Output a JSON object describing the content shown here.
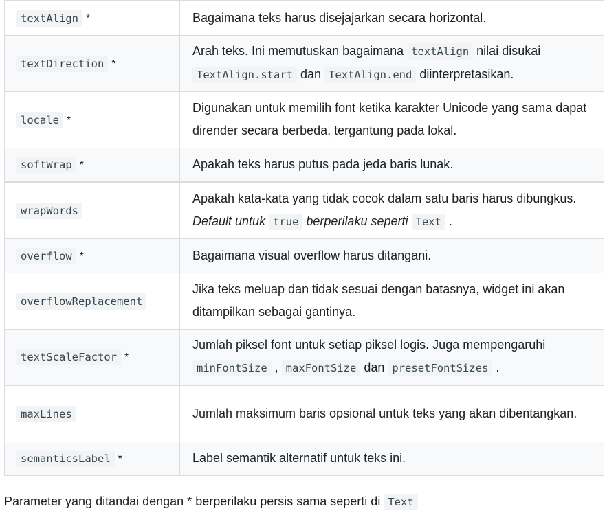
{
  "rows": [
    {
      "name": "textAlign",
      "star": "*",
      "desc": "Bagaimana teks harus disejajarkan secara horizontal."
    },
    {
      "name": "textDirection",
      "star": "*",
      "d1": "Arah teks. Ini memutuskan bagaimana ",
      "c1": "textAlign",
      "d2": " nilai disukai ",
      "c2": "TextAlign.start",
      "d3": " dan ",
      "c3": "TextAlign.end",
      "d4": " diinterpretasikan."
    },
    {
      "name": "locale",
      "star": "*",
      "desc": "Digunakan untuk memilih font ketika karakter Unicode yang sama dapat dirender secara berbeda, tergantung pada lokal."
    },
    {
      "name": "softWrap",
      "star": "*",
      "desc": "Apakah teks harus putus pada jeda baris lunak."
    },
    {
      "name": "wrapWords",
      "d1": "Apakah kata-kata yang tidak cocok dalam satu baris harus dibungkus. ",
      "e1": "Default untuk ",
      "c1": "true",
      "e2": " berperilaku seperti ",
      "c2": "Text",
      "d2": " ."
    },
    {
      "name": "overflow",
      "star": "*",
      "desc": "Bagaimana visual overflow harus ditangani."
    },
    {
      "name": "overflowReplacement",
      "desc": "Jika teks meluap dan tidak sesuai dengan batasnya, widget ini akan ditampilkan sebagai gantinya."
    },
    {
      "name": "textScaleFactor",
      "star": "*",
      "d1": "Jumlah piksel font untuk setiap piksel logis. Juga mempengaruhi ",
      "c1": "minFontSize",
      "d2": " , ",
      "c2": "maxFontSize",
      "d3": " dan ",
      "c3": "presetFontSizes",
      "d4": " ."
    },
    {
      "name": "maxLines",
      "desc": "Jumlah maksimum baris opsional untuk teks yang akan dibentangkan."
    },
    {
      "name": "semanticsLabel",
      "star": "*",
      "desc": "Label semantik alternatif untuk teks ini."
    }
  ],
  "footer": {
    "text": "Parameter yang ditandai dengan * berperilaku persis sama seperti di ",
    "code": "Text"
  }
}
